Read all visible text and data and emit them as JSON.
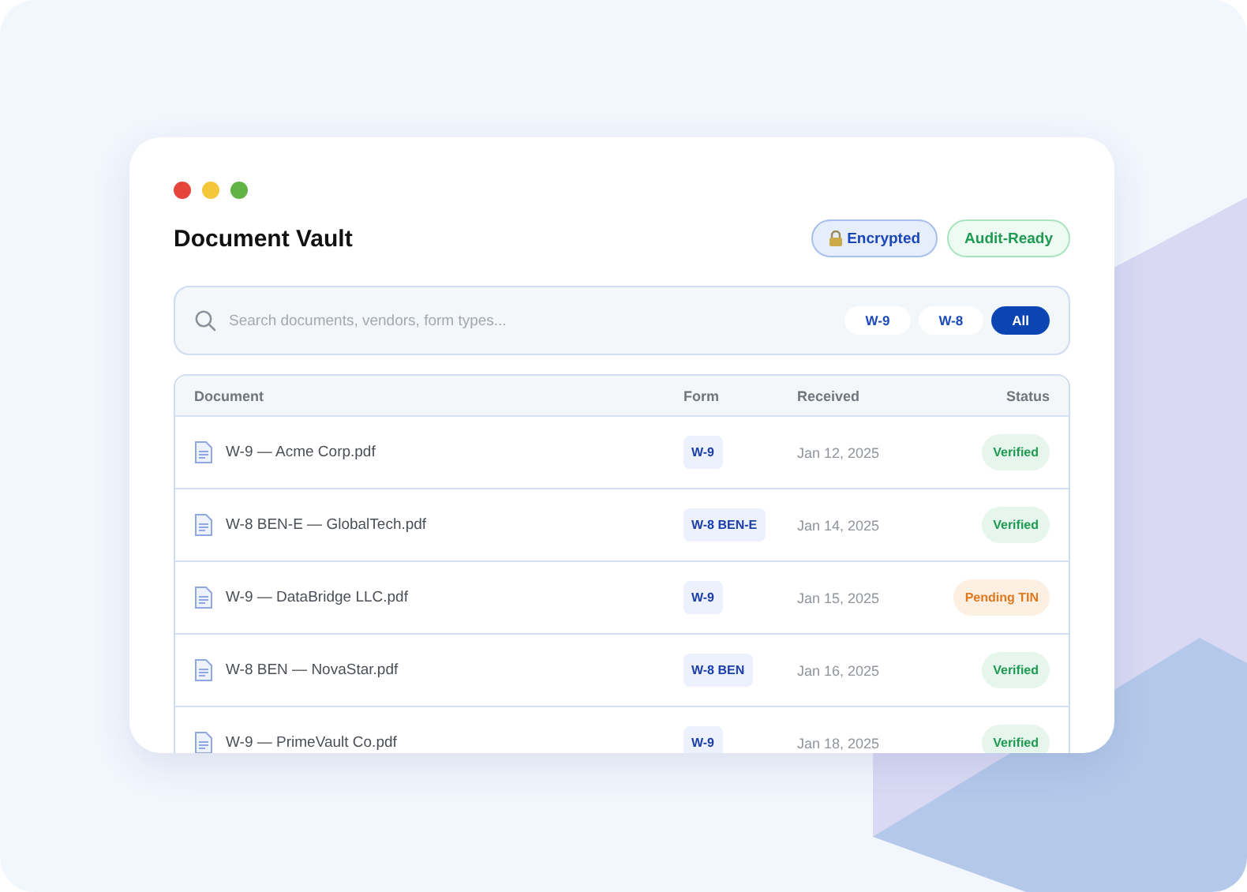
{
  "window": {
    "title": "Document Vault"
  },
  "badges": [
    {
      "label": "Encrypted",
      "kind": "encrypted"
    },
    {
      "label": "Audit-Ready",
      "kind": "audit"
    }
  ],
  "search": {
    "placeholder": "Search documents, vendors, form types..."
  },
  "filters": [
    {
      "label": "W-9",
      "selected": false
    },
    {
      "label": "W-8",
      "selected": false
    },
    {
      "label": "All",
      "selected": true
    }
  ],
  "table": {
    "columns": [
      "Document",
      "Form",
      "Received",
      "Status"
    ],
    "rows": [
      {
        "document": "W-9 — Acme Corp.pdf",
        "form": "W-9",
        "received": "Jan 12, 2025",
        "status": "Verified",
        "kind": "verified"
      },
      {
        "document": "W-8 BEN-E — GlobalTech.pdf",
        "form": "W-8 BEN-E",
        "received": "Jan 14, 2025",
        "status": "Verified",
        "kind": "verified"
      },
      {
        "document": "W-9 — DataBridge LLC.pdf",
        "form": "W-9",
        "received": "Jan 15, 2025",
        "status": "Pending TIN",
        "kind": "pending"
      },
      {
        "document": "W-8 BEN — NovaStar.pdf",
        "form": "W-8 BEN",
        "received": "Jan 16, 2025",
        "status": "Verified",
        "kind": "verified"
      },
      {
        "document": "W-9 — PrimeVault Co.pdf",
        "form": "W-9",
        "received": "Jan 18, 2025",
        "status": "Verified",
        "kind": "verified"
      }
    ]
  }
}
